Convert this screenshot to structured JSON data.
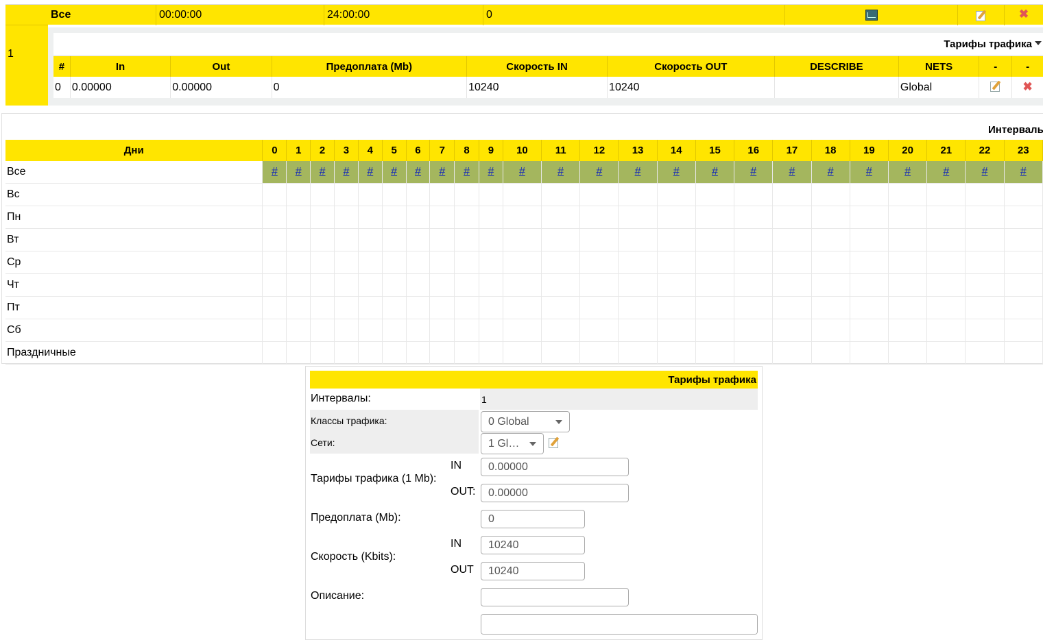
{
  "top_row": {
    "name": "Все",
    "begin": "00:00:00",
    "end": "24:00:00",
    "value": "0",
    "interval_id": "1"
  },
  "tariffs": {
    "title": "Тарифы трафика",
    "columns": [
      "#",
      "In",
      "Out",
      "Предоплата (Mb)",
      "Скорость IN",
      "Скорость OUT",
      "DESCRIBE",
      "NETS",
      "-",
      "-"
    ],
    "rows": [
      {
        "num": "0",
        "in": "0.00000",
        "out": "0.00000",
        "prepaid": "0",
        "speed_in": "10240",
        "speed_out": "10240",
        "describe": "",
        "nets": "Global"
      }
    ]
  },
  "intervals": {
    "title": "Интервалы",
    "days_header": "Дни",
    "hours": [
      "0",
      "1",
      "2",
      "3",
      "4",
      "5",
      "6",
      "7",
      "8",
      "9",
      "10",
      "11",
      "12",
      "13",
      "14",
      "15",
      "16",
      "17",
      "18",
      "19",
      "20",
      "21",
      "22",
      "23"
    ],
    "all_label": "Все",
    "hour_link": "#",
    "days": [
      "Вс",
      "Пн",
      "Вт",
      "Ср",
      "Чт",
      "Пт",
      "Сб",
      "Праздничные"
    ]
  },
  "form": {
    "title": "Тарифы трафика",
    "intervals_label": "Интервалы:",
    "intervals_value": "1",
    "classes_label": "Классы трафика:",
    "classes_value": "0 Global",
    "nets_label": "Сети:",
    "nets_value": "1 Gl…",
    "tariff_label": "Тарифы трафика (1 Mb):",
    "in_label": "IN",
    "out_label": "OUT:",
    "tariff_in": "0.00000",
    "tariff_out": "0.00000",
    "prepaid_label": "Предоплата (Mb):",
    "prepaid_value": "0",
    "speed_label": "Скорость (Kbits):",
    "speed_in_label": "IN",
    "speed_out_label": "OUT",
    "speed_in": "10240",
    "speed_out": "10240",
    "describe_label": "Описание:",
    "describe_value": ""
  }
}
